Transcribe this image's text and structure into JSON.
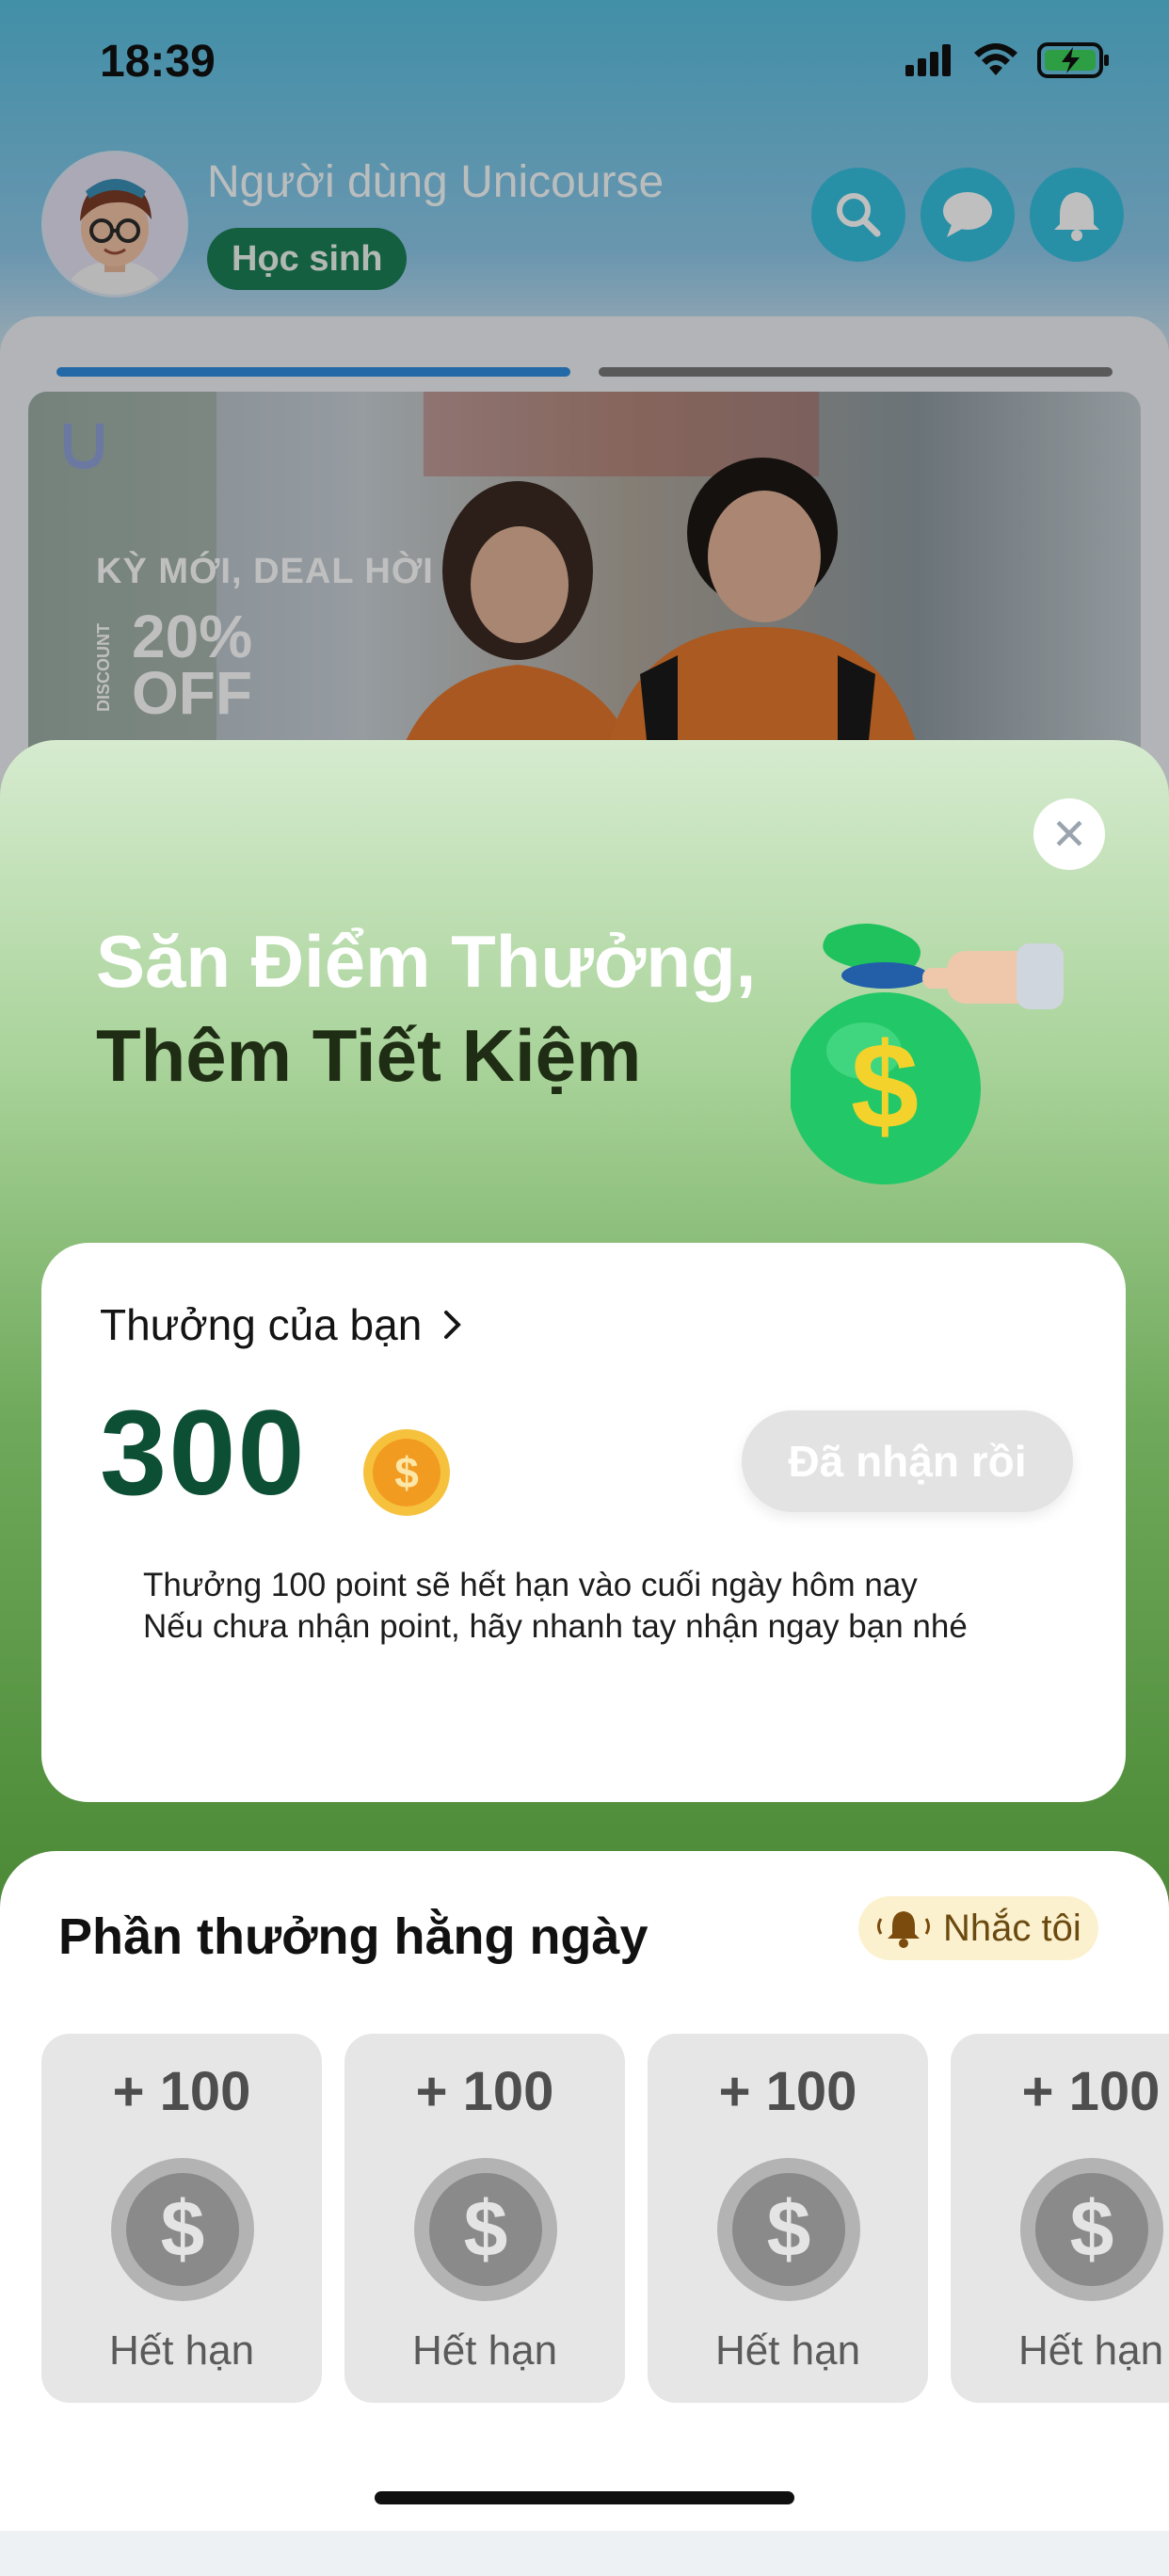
{
  "status_bar": {
    "time": "18:39"
  },
  "header": {
    "user_name": "Người dùng Unicourse",
    "role": "Học sinh"
  },
  "banner": {
    "line1": "KỲ MỚI, DEAL HỜI",
    "big": "20%",
    "big2": "OFF",
    "side": "DISCOUNT"
  },
  "sheet": {
    "title_line1": "Săn Điểm Thưởng,",
    "title_line2": "Thêm Tiết Kiệm",
    "reward": {
      "heading": "Thưởng của bạn",
      "points": "300",
      "claimed_label": "Đã nhận rồi",
      "note_line1": "Thưởng 100 point sẽ hết hạn vào cuối ngày hôm nay",
      "note_line2": "Nếu chưa nhận point, hãy nhanh tay nhận ngay bạn nhé"
    },
    "daily": {
      "title": "Phần thưởng hằng ngày",
      "remind_label": "Nhắc tôi",
      "items": [
        {
          "points": "+ 100",
          "status": "Hết hạn"
        },
        {
          "points": "+ 100",
          "status": "Hết hạn"
        },
        {
          "points": "+ 100",
          "status": "Hết hạn"
        },
        {
          "points": "+ 100",
          "status": "Hết hạn"
        }
      ]
    }
  },
  "colors": {
    "brand_green": "#0d4f35",
    "badge_green": "#1b7f56",
    "header_button": "#36c0de",
    "tab_active": "#2f8ddf",
    "tab_inactive": "#777777"
  }
}
